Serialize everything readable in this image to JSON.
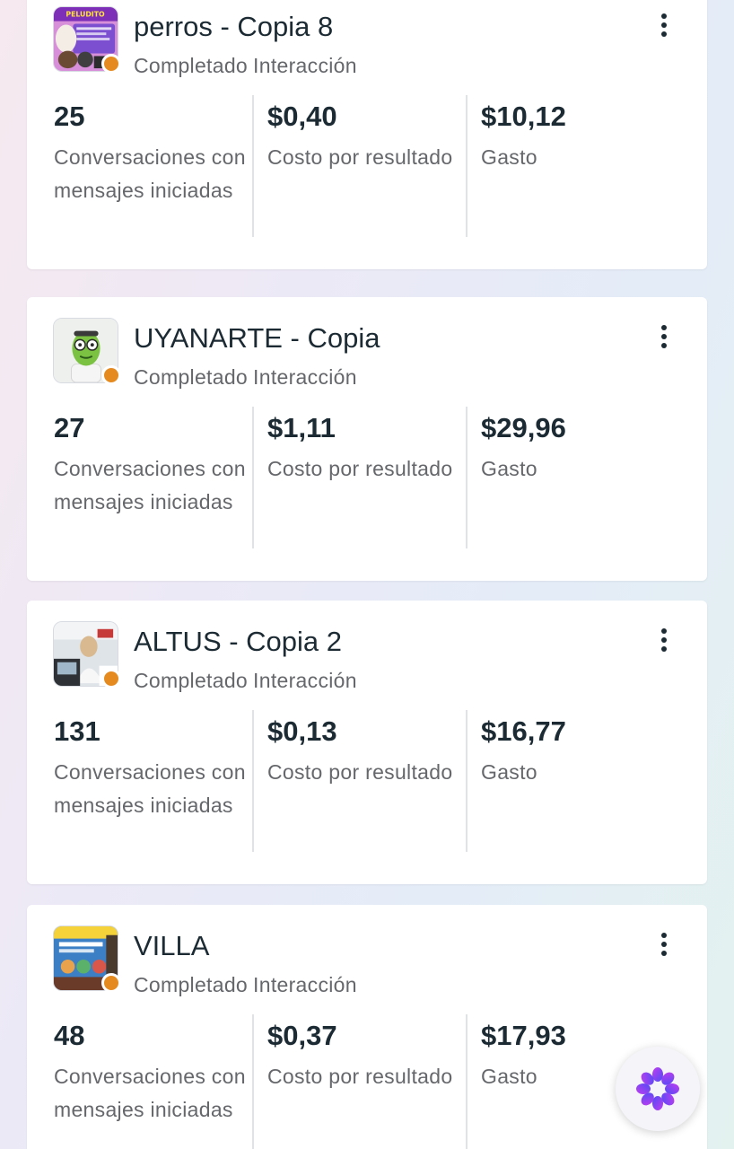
{
  "campaigns": [
    {
      "name": "perros - Copia 8",
      "status": "Completado",
      "objective": "Interacción",
      "results_value": "25",
      "results_label": "Conversaciones con mensajes iniciadas",
      "cost_value": "$0,40",
      "cost_label": "Costo por resultado",
      "spend_value": "$10,12",
      "spend_label": "Gasto",
      "thumbnail": "pet-flyer-thumbnail",
      "thumbnail_text": "PELUDITO"
    },
    {
      "name": "UYANARTE - Copia",
      "status": "Completado",
      "objective": "Interacción",
      "results_value": "27",
      "results_label": "Conversaciones con mensajes iniciadas",
      "cost_value": "$1,11",
      "cost_label": "Costo por resultado",
      "spend_value": "$29,96",
      "spend_label": "Gasto",
      "thumbnail": "green-character-thumbnail"
    },
    {
      "name": "ALTUS - Copia 2",
      "status": "Completado",
      "objective": "Interacción",
      "results_value": "131",
      "results_label": "Conversaciones con mensajes iniciadas",
      "cost_value": "$0,13",
      "cost_label": "Costo por resultado",
      "spend_value": "$16,77",
      "spend_label": "Gasto",
      "thumbnail": "office-photo-thumbnail"
    },
    {
      "name": "VILLA",
      "status": "Completado",
      "objective": "Interacción",
      "results_value": "48",
      "results_label": "Conversaciones con mensajes iniciadas",
      "cost_value": "$0,37",
      "cost_label": "Costo por resultado",
      "spend_value": "$17,93",
      "spend_label": "Gasto",
      "thumbnail": "travel-flyer-thumbnail"
    }
  ],
  "colors": {
    "status_dot": "#e58a1f",
    "title_text": "#1c2b33",
    "secondary_text": "#65676b",
    "fab_icon": "#8a3ffc"
  },
  "icons": {
    "more": "more-vertical-icon",
    "assistant": "ai-assistant-icon"
  }
}
